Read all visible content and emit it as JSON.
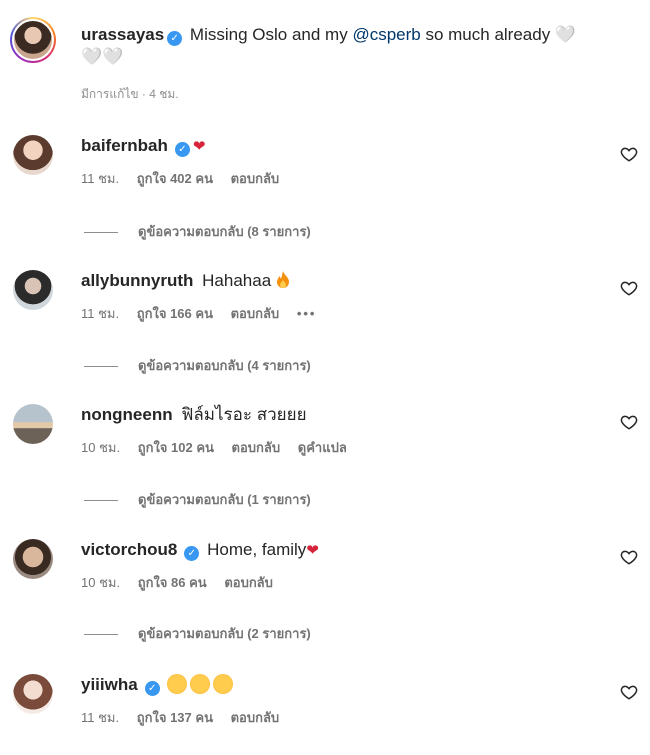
{
  "caption": {
    "username": "urassayas",
    "text": "Missing Oslo and my",
    "mention": "@csperb",
    "text_after": "so much already 🤍",
    "text_line2": "🤍🤍",
    "meta": "มีการแก้ไข · 4 ชม."
  },
  "comments": [
    {
      "username": "baifernbah",
      "text": "",
      "emoji_after": "❤",
      "time": "11 ชม.",
      "likes": "ถูกใจ 402 คน",
      "reply": "ตอบกลับ",
      "replies": "ดูข้อความตอบกลับ (8 รายการ)",
      "avatar_colors": [
        "#f2d3c0",
        "#5a3b2e"
      ]
    },
    {
      "username": "allybunnyruth",
      "text": "Hahahaa",
      "emoji_after": "fire",
      "time": "11 ชม.",
      "likes": "ถูกใจ 166 คน",
      "reply": "ตอบกลับ",
      "more": "•••",
      "replies": "ดูข้อความตอบกลับ (4 รายการ)",
      "avatar_colors": [
        "#d9d9d9",
        "#2b2b2b"
      ]
    },
    {
      "username": "nongneenn",
      "text": "ฟิล์มไรอะ สวยยย",
      "time": "10 ชม.",
      "likes": "ถูกใจ 102 คน",
      "reply": "ตอบกลับ",
      "translate": "ดูคำแปล",
      "replies": "ดูข้อความตอบกลับ (1 รายการ)",
      "avatar_colors": [
        "#b7c3cc",
        "#6d6258"
      ]
    },
    {
      "username": "victorchou8",
      "text": "Home, family",
      "emoji_after": "❤",
      "time": "10 ชม.",
      "likes": "ถูกใจ 86 คน",
      "reply": "ตอบกลับ",
      "replies": "ดูข้อความตอบกลับ (2 รายการ)",
      "avatar_colors": [
        "#d8b79d",
        "#3a2b22"
      ]
    },
    {
      "username": "yiiiwha",
      "text": "",
      "emoji_after": "heart-eyes x3",
      "time": "11 ชม.",
      "likes": "ถูกใจ 137 คน",
      "reply": "ตอบกลับ",
      "avatar_colors": [
        "#f3dcd0",
        "#7a4b3a"
      ]
    }
  ],
  "icons": {
    "verified": "verified-badge-icon",
    "like": "heart-outline-icon"
  },
  "colors": {
    "verified": "#3897f0",
    "mention": "#00376b",
    "meta": "#737373"
  }
}
